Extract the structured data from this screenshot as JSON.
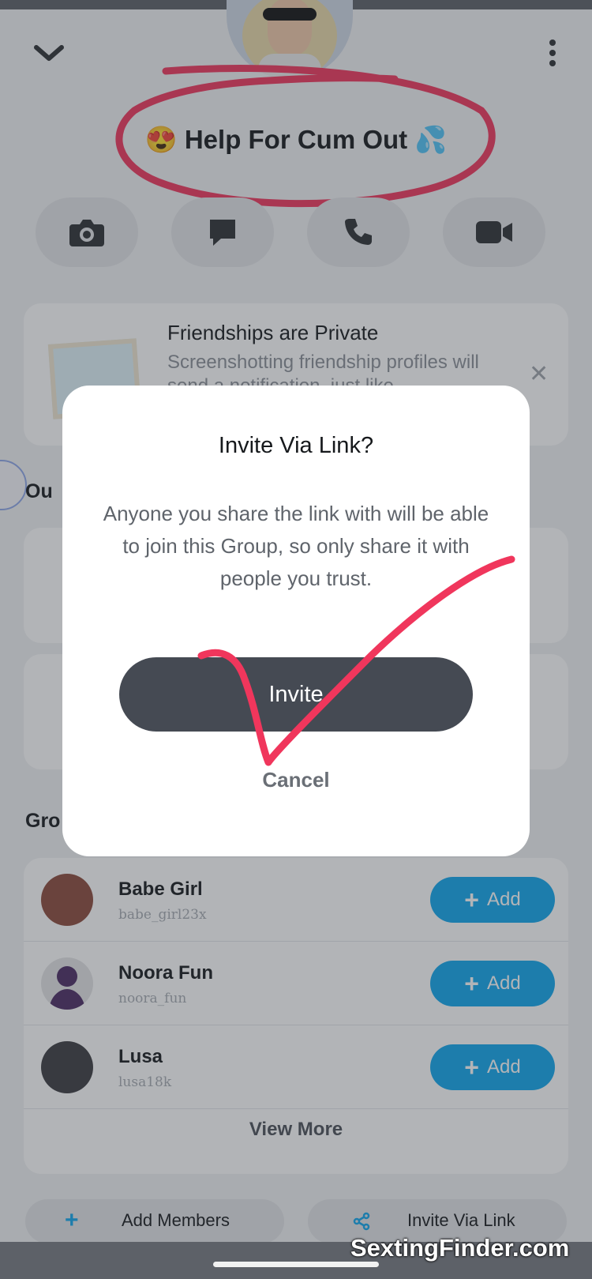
{
  "group": {
    "title": "😍 Help For Cum Out 💦"
  },
  "info_card": {
    "title": "Friendships are Private",
    "description": "Screenshotting friendship profiles will send a notification, just like",
    "close": "✕"
  },
  "sections": {
    "ours_label": "Ou",
    "group_label": "Gro"
  },
  "members": [
    {
      "name": "Babe Girl",
      "username": "babe_girl23x",
      "add_label": "Add"
    },
    {
      "name": "Noora Fun",
      "username": "noora_fun",
      "add_label": "Add"
    },
    {
      "name": "Lusa",
      "username": "lusa18k",
      "add_label": "Add"
    }
  ],
  "view_more": "View More",
  "bottom": {
    "add_members": "Add Members",
    "invite_link": "Invite Via Link"
  },
  "dialog": {
    "title": "Invite Via Link?",
    "body": "Anyone you share the link with will be able to join this Group, so only share it with people you trust.",
    "invite": "Invite",
    "cancel": "Cancel"
  },
  "watermark": "SextingFinder.com",
  "colors": {
    "accent": "#0fa6ee",
    "annotation": "#f0365c",
    "dialog_button": "#454a53"
  },
  "icons": [
    "chevron-down-icon",
    "more-vertical-icon",
    "camera-icon",
    "chat-icon",
    "phone-icon",
    "video-icon",
    "close-icon",
    "plus-icon",
    "share-icon"
  ]
}
